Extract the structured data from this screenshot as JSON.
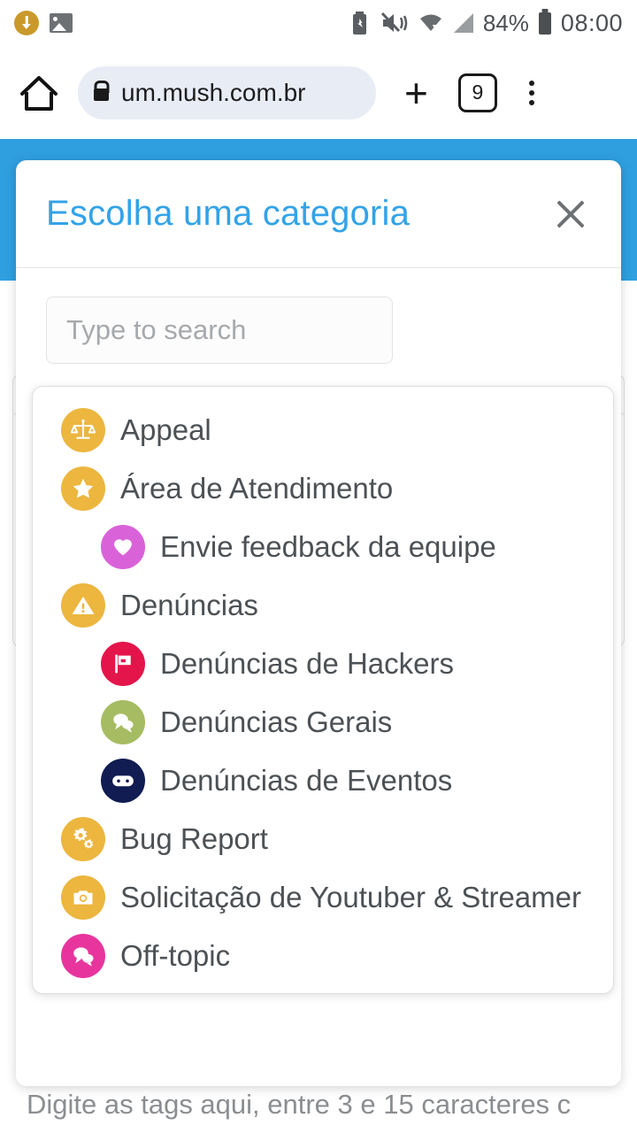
{
  "status_bar": {
    "left_icons": [
      {
        "name": "download-icon",
        "label": "download"
      },
      {
        "name": "screenshot-image-icon",
        "label": "image"
      }
    ],
    "right_icons": [
      {
        "name": "battery-saver-icon",
        "glyph": "♻"
      },
      {
        "name": "mute-vibrate-icon",
        "glyph": "🔇"
      },
      {
        "name": "wifi-icon",
        "glyph": "📶"
      },
      {
        "name": "cell-signal-icon",
        "glyph": ""
      }
    ],
    "battery_percent": "84%",
    "time": "08:00"
  },
  "browser": {
    "home_icon": "home-icon",
    "lock_icon": "lock-icon",
    "url": "um.mush.com.br",
    "new_tab_label": "+",
    "tab_count": "9",
    "menu_icon": "kebab-menu-icon"
  },
  "modal": {
    "title": "Escolha uma categoria",
    "close_label": "×",
    "search": {
      "value": "",
      "placeholder": "Type to search"
    },
    "categories": [
      {
        "label": "Appeal",
        "icon": "scales-icon",
        "color": "#ecb63f",
        "indent": 0
      },
      {
        "label": "Área de Atendimento",
        "icon": "star-icon",
        "color": "#ecb63f",
        "indent": 0
      },
      {
        "label": "Envie feedback da equipe",
        "icon": "heart-icon",
        "color": "#d962d9",
        "indent": 1
      },
      {
        "label": "Denúncias",
        "icon": "warning-icon",
        "color": "#ecb63f",
        "indent": 0
      },
      {
        "label": "Denúncias de Hackers",
        "icon": "flag-icon",
        "color": "#e4154b",
        "indent": 1
      },
      {
        "label": "Denúncias Gerais",
        "icon": "chat-bubbles-icon",
        "color": "#a6bc62",
        "indent": 1
      },
      {
        "label": "Denúncias de Eventos",
        "icon": "gamepad-icon",
        "color": "#101c52",
        "indent": 1
      },
      {
        "label": "Bug Report",
        "icon": "gears-icon",
        "color": "#ecb63f",
        "indent": 0
      },
      {
        "label": "Solicitação de Youtuber & Streamer",
        "icon": "camera-icon",
        "color": "#ecb63f",
        "indent": 0
      },
      {
        "label": "Off-topic",
        "icon": "chat-bubbles-icon",
        "color": "#e8359e",
        "indent": 0
      }
    ]
  },
  "page": {
    "tag_hint": "Digite as tags aqui, entre 3 e 15 caracteres c",
    "accent_blue": "#2f9fe0",
    "title_blue": "#33a3e8"
  }
}
